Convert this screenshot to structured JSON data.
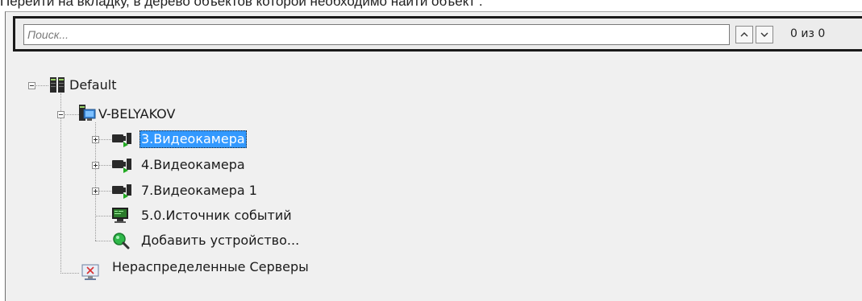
{
  "caption": "Перейти на вкладку, в дерево объектов которой необходимо найти объект .",
  "search": {
    "placeholder": "Поиск...",
    "value": "",
    "prev_icon": "chevron-up-icon",
    "next_icon": "chevron-down-icon",
    "counter": "0 из 0"
  },
  "tree": {
    "root": {
      "label": "Default",
      "icon": "server-rack-icon",
      "expanded": true
    },
    "server": {
      "label": "V-BELYAKOV",
      "icon": "server-computer-icon",
      "expanded": true
    },
    "children": [
      {
        "label": "3.Видеокамера",
        "icon": "video-camera-icon",
        "expander": "plus",
        "selected": true
      },
      {
        "label": "4.Видеокамера",
        "icon": "video-camera-icon",
        "expander": "plus",
        "selected": false
      },
      {
        "label": "7.Видеокамера 1",
        "icon": "video-camera-icon",
        "expander": "plus",
        "selected": false
      },
      {
        "label": "5.0.Источник событий",
        "icon": "event-source-icon",
        "expander": "none",
        "selected": false
      },
      {
        "label": "Добавить устройство...",
        "icon": "search-add-icon",
        "expander": "none",
        "selected": false
      }
    ],
    "unassigned": {
      "label": "Нераспределенные Серверы",
      "icon": "unassigned-servers-icon"
    }
  },
  "colors": {
    "selection": "#3399ff",
    "panel_bg": "#f0f0f0",
    "camera_accent": "#22aa22"
  }
}
